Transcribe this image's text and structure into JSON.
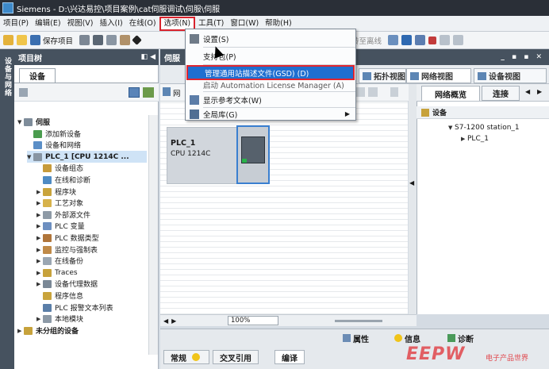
{
  "window": {
    "title": "Siemens  -  D:\\兴达易控\\项目案例\\cat伺服调试\\伺服\\伺服"
  },
  "menubar": {
    "items": [
      "项目(P)",
      "编辑(E)",
      "视图(V)",
      "插入(I)",
      "在线(O)",
      "选项(N)",
      "工具(T)",
      "窗口(W)",
      "帮助(H)"
    ],
    "open_index": 5
  },
  "toolbar": {
    "save_label": "保存项目",
    "offline_label": "转至离线"
  },
  "options_menu": {
    "items": [
      {
        "label": "设置(S)",
        "icon": "settings-icon"
      },
      {
        "label": "支持包(P)",
        "icon": ""
      },
      {
        "label": "管理通用站描述文件(GSD) (D)",
        "icon": "",
        "highlighted": true
      },
      {
        "label": "启动 Automation License Manager (A)",
        "icon": ""
      },
      {
        "label": "显示参考文本(W)",
        "icon": "reference-text-icon"
      },
      {
        "label": "全局库(G)",
        "icon": "global-library-icon",
        "submenu": true
      }
    ]
  },
  "side_strip": {
    "label": "设备与网络"
  },
  "project_tree": {
    "title": "项目树",
    "devices_tab": "设备",
    "items": [
      {
        "label": "伺服",
        "level": 0,
        "arrow": "▼"
      },
      {
        "label": "添加新设备",
        "level": 1,
        "arrow": ""
      },
      {
        "label": "设备和网络",
        "level": 1,
        "arrow": ""
      },
      {
        "label": "PLC_1 [CPU 1214C ...",
        "level": 1,
        "arrow": "▼",
        "selected": true
      },
      {
        "label": "设备组态",
        "level": 2,
        "arrow": ""
      },
      {
        "label": "在线和诊断",
        "level": 2,
        "arrow": ""
      },
      {
        "label": "程序块",
        "level": 2,
        "arrow": "▶"
      },
      {
        "label": "工艺对象",
        "level": 2,
        "arrow": "▶"
      },
      {
        "label": "外部源文件",
        "level": 2,
        "arrow": "▶"
      },
      {
        "label": "PLC 变量",
        "level": 2,
        "arrow": "▶"
      },
      {
        "label": "PLC 数据类型",
        "level": 2,
        "arrow": "▶"
      },
      {
        "label": "监控与强制表",
        "level": 2,
        "arrow": "▶"
      },
      {
        "label": "在线备份",
        "level": 2,
        "arrow": "▶"
      },
      {
        "label": "Traces",
        "level": 2,
        "arrow": "▶"
      },
      {
        "label": "设备代理数据",
        "level": 2,
        "arrow": "▶"
      },
      {
        "label": "程序信息",
        "level": 2,
        "arrow": ""
      },
      {
        "label": "PLC 报警文本列表",
        "level": 2,
        "arrow": ""
      },
      {
        "label": "本地模块",
        "level": 2,
        "arrow": "▶"
      },
      {
        "label": "未分组的设备",
        "level": 0,
        "arrow": "▶"
      }
    ]
  },
  "editor": {
    "title": "伺服",
    "tabs": [
      "拓扑视图",
      "网络视图",
      "设备视图"
    ],
    "active_tab": 1,
    "canvas_tab": "网",
    "plc_name": "PLC_1",
    "plc_cpu": "CPU 1214C",
    "zoom": "100%"
  },
  "network_overview": {
    "tabs": [
      "网络概览",
      "连接"
    ],
    "column": "设备",
    "rows": [
      {
        "label": "S7-1200 station_1",
        "arrow": "▼"
      },
      {
        "label": "PLC_1",
        "arrow": "▶"
      }
    ]
  },
  "inspector": {
    "tabs": [
      "属性",
      "信息",
      "诊断"
    ],
    "bottom_tabs": [
      "常规",
      "交叉引用",
      "编译"
    ]
  },
  "watermark": {
    "text": "EEPW",
    "sub": "电子产品世界"
  }
}
